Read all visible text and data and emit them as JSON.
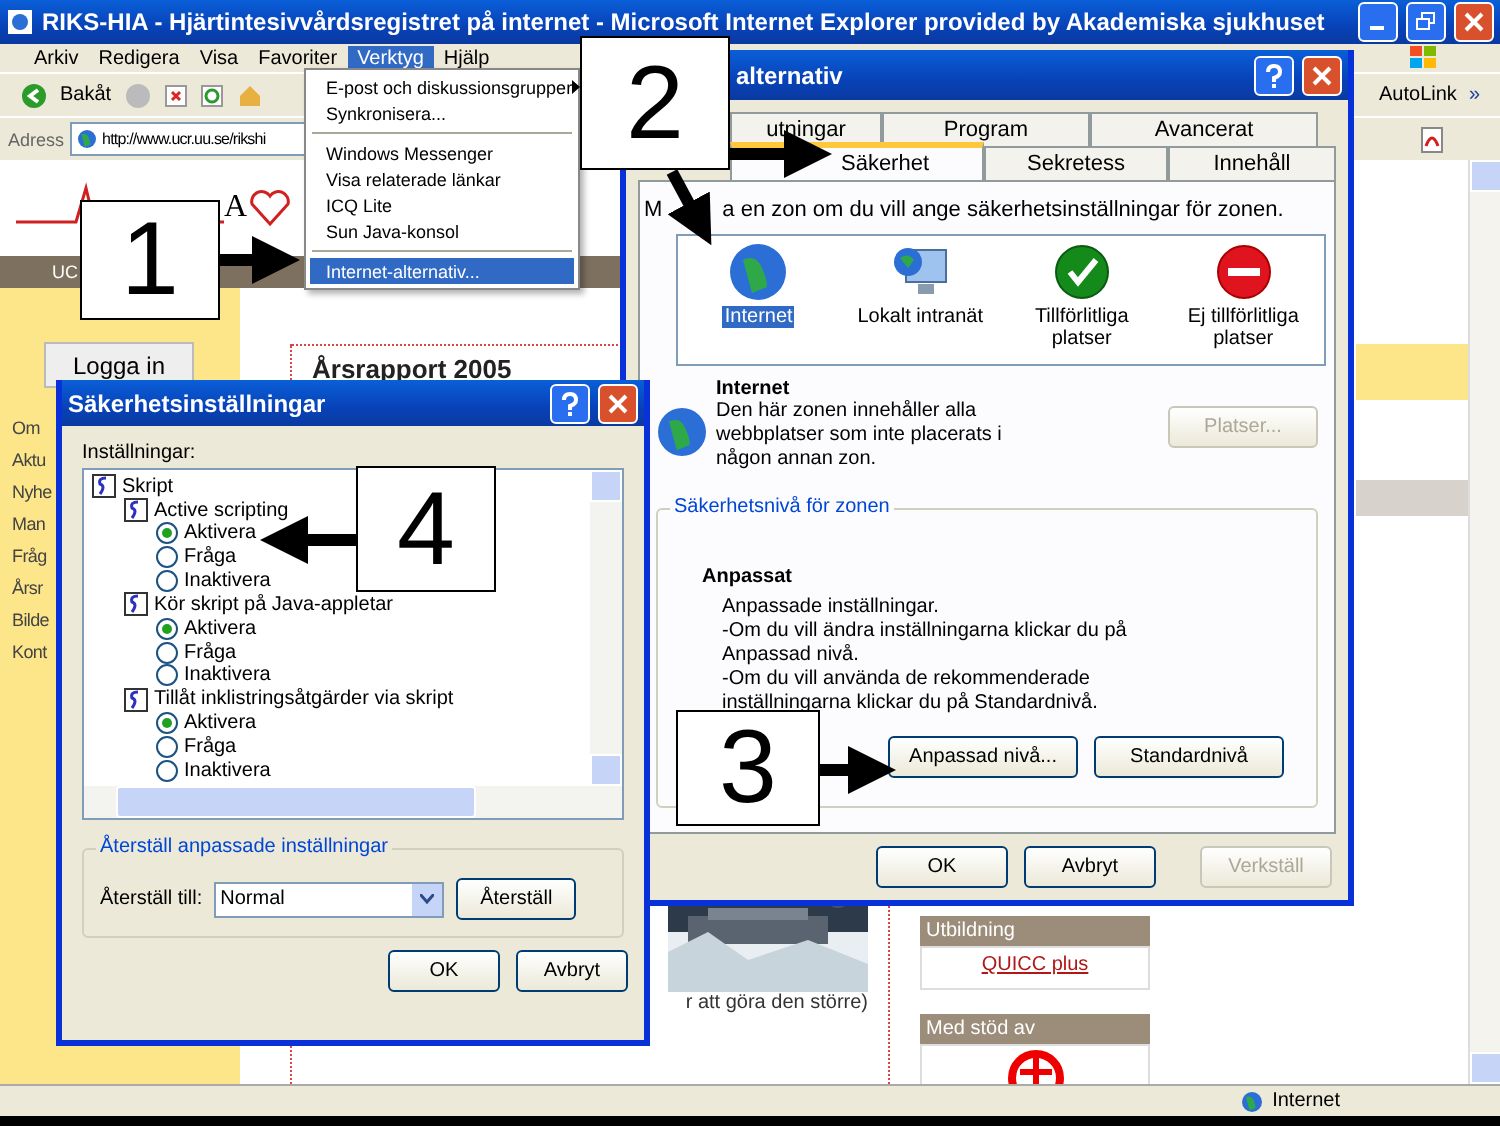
{
  "browser": {
    "title": "RIKS-HIA - Hjärtintesivvårdsregistret på internet - Microsoft Internet Explorer provided by Akademiska sjukhuset",
    "menu": [
      {
        "label": "Arkiv",
        "selected": false
      },
      {
        "label": "Redigera",
        "selected": false
      },
      {
        "label": "Visa",
        "selected": false
      },
      {
        "label": "Favoriter",
        "selected": false
      },
      {
        "label": "Verktyg",
        "selected": true
      },
      {
        "label": "Hjälp",
        "selected": false
      }
    ],
    "back": "Bakåt",
    "autolink": "AutoLink",
    "chevron": "»",
    "address_label": "Adress",
    "address": "http://www.ucr.uu.se/rikshi",
    "status": "Internet"
  },
  "tools_menu": [
    [
      {
        "label": "E-post och diskussionsgrupper",
        "submenu": true,
        "selected": false
      },
      {
        "label": "Synkronisera...",
        "submenu": false,
        "selected": false
      }
    ],
    [
      {
        "label": "Windows Messenger",
        "submenu": false,
        "selected": false
      },
      {
        "label": "Visa relaterade länkar",
        "submenu": false,
        "selected": false
      },
      {
        "label": "ICQ Lite",
        "submenu": false,
        "selected": false
      },
      {
        "label": "Sun Java-konsol",
        "submenu": false,
        "selected": false
      }
    ],
    [
      {
        "label": "Internet-alternativ...",
        "submenu": false,
        "selected": true
      }
    ]
  ],
  "page": {
    "logo_letter": "A",
    "nav_tab": "UC",
    "login": "Logga in",
    "nav_links": [
      "Om",
      "Aktu",
      "Nyhe",
      "Man",
      "Fråg",
      "Årsr",
      "Bilde",
      "Kont"
    ],
    "heading": "Årsrapport 2005",
    "caption": "r att göra den större)",
    "boxes": [
      {
        "title": "Utbildning",
        "link": "QUICC plus"
      },
      {
        "title": "Med stöd av"
      }
    ]
  },
  "internet_options": {
    "title": "alternativ",
    "tabs_back": [
      {
        "label": "utningar",
        "selected": false
      },
      {
        "label": "Program",
        "selected": false
      },
      {
        "label": "Avancerat",
        "selected": false
      }
    ],
    "tabs_front": [
      {
        "label": "Säkerhet",
        "selected": true
      },
      {
        "label": "Sekretess",
        "selected": false
      },
      {
        "label": "Innehåll",
        "selected": false
      }
    ],
    "intro": [
      "M",
      "a en zon om du vill ange säkerhetsinställningar för zonen."
    ],
    "zones": [
      {
        "kind": "globe",
        "label": "Internet",
        "selected": true
      },
      {
        "kind": "intranet",
        "label": "Lokalt intranät",
        "selected": false
      },
      {
        "kind": "trusted",
        "label": "Tillförlitliga platser",
        "selected": false
      },
      {
        "kind": "restricted",
        "label": "Ej tillförlitliga platser",
        "selected": false
      }
    ],
    "zone_name": "Internet",
    "zone_text": "Den här zonen innehåller alla webbplatser som inte placerats i någon annan zon.",
    "sites_button": {
      "label": "Platser...",
      "disabled": true
    },
    "group_title": "Säkerhetsnivå för zonen",
    "level_name": "Anpassat",
    "level_lines": [
      "Anpassade inställningar.",
      "-Om du vill ändra inställningarna klickar du på Anpassad nivå.",
      "-Om du vill använda de rekommenderade inställningarna klickar du på Standardnivå."
    ],
    "level_buttons": [
      "Anpassad nivå...",
      "Standardnivå"
    ],
    "buttons": [
      {
        "label": "OK",
        "disabled": false
      },
      {
        "label": "Avbryt",
        "disabled": false
      },
      {
        "label": "Verkställ",
        "disabled": true
      }
    ]
  },
  "security_settings": {
    "title": "Säkerhetsinställningar",
    "list_label": "Inställningar:",
    "tree": [
      {
        "label": "Skript",
        "children": [
          {
            "label": "Active scripting",
            "options": [
              {
                "label": "Aktivera",
                "selected": true
              },
              {
                "label": "Fråga",
                "selected": false
              },
              {
                "label": "Inaktivera",
                "selected": false
              }
            ]
          },
          {
            "label": "Kör skript på Java-appletar",
            "options": [
              {
                "label": "Aktivera",
                "selected": true
              },
              {
                "label": "Fråga",
                "selected": false
              },
              {
                "label": "Inaktivera",
                "selected": false
              }
            ]
          },
          {
            "label": "Tillåt inklistringsåtgärder via skript",
            "options": [
              {
                "label": "Aktivera",
                "selected": true
              },
              {
                "label": "Fråga",
                "selected": false
              },
              {
                "label": "Inaktivera",
                "selected": false
              }
            ]
          }
        ]
      }
    ],
    "reset_group": "Återställ anpassade inställningar",
    "reset_label": "Återställ till:",
    "reset_value": "Normal",
    "reset_button": "Återställ",
    "buttons": [
      "OK",
      "Avbryt"
    ]
  },
  "callouts": [
    "1",
    "2",
    "3",
    "4"
  ]
}
